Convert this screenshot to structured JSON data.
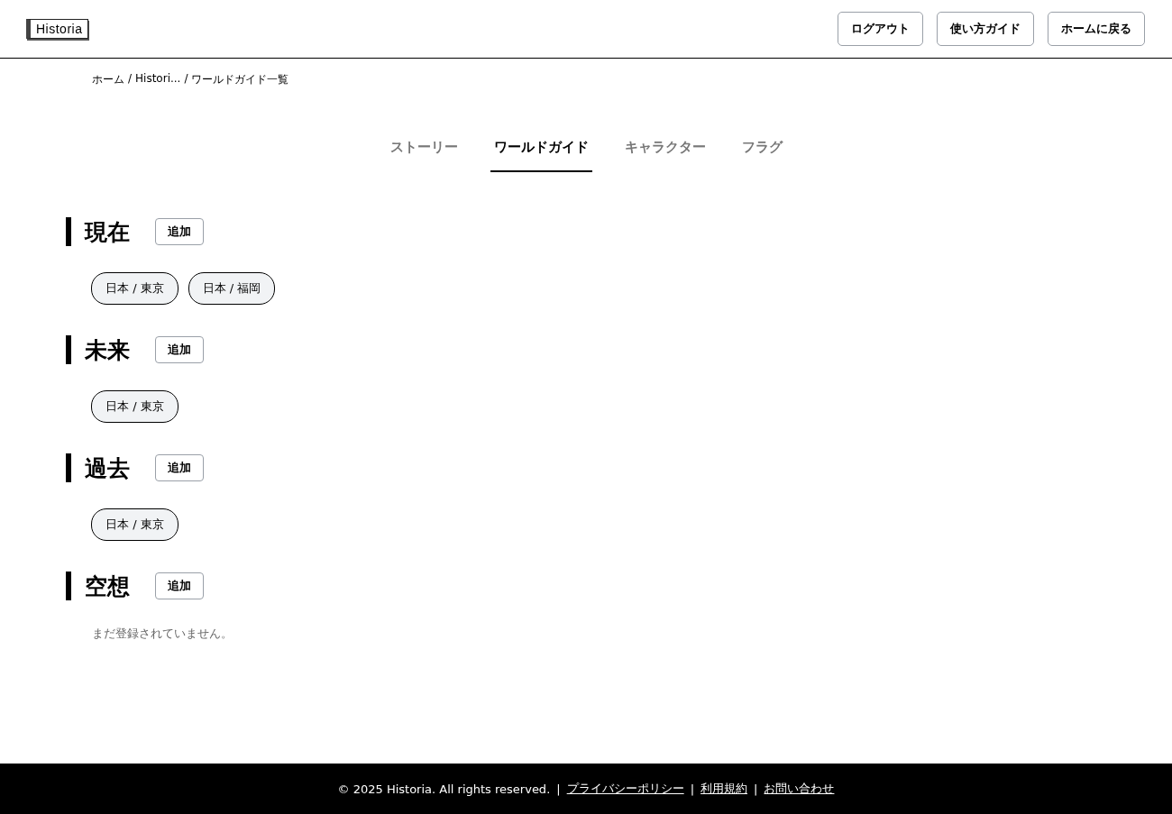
{
  "header": {
    "logo": "Historia",
    "buttons": [
      "ログアウト",
      "使い方ガイド",
      "ホームに戻る"
    ]
  },
  "breadcrumb": [
    {
      "text": "ホーム",
      "separator": "/"
    },
    {
      "text": "Histori...",
      "separator": "/"
    },
    {
      "text": "ワールドガイド一覧"
    }
  ],
  "tabs": [
    {
      "label": "ストーリー",
      "selected": false
    },
    {
      "label": "ワールドガイド",
      "selected": true
    },
    {
      "label": "キャラクター",
      "selected": false
    },
    {
      "label": "フラグ",
      "selected": false
    }
  ],
  "sections": [
    {
      "title": "現在",
      "add_button": "追加",
      "tags": [
        "日本 / 東京",
        "日本 / 福岡"
      ]
    },
    {
      "title": "未来",
      "add_button": "追加",
      "tags": [
        "日本 / 東京"
      ]
    },
    {
      "title": "過去",
      "add_button": "追加",
      "tags": [
        "日本 / 東京"
      ]
    },
    {
      "title": "空想",
      "add_button": "追加",
      "empty_message": "まだ登録されていません。"
    }
  ],
  "footer": [
    {
      "kind": "text",
      "text": "© 2025 Historia. All rights reserved."
    },
    {
      "kind": "separator",
      "text": "|"
    },
    {
      "kind": "link",
      "text": "プライバシーポリシー"
    },
    {
      "kind": "separator",
      "text": "|"
    },
    {
      "kind": "link",
      "text": "利用規約"
    },
    {
      "kind": "separator",
      "text": "|"
    },
    {
      "kind": "link",
      "text": "お問い合わせ"
    }
  ]
}
